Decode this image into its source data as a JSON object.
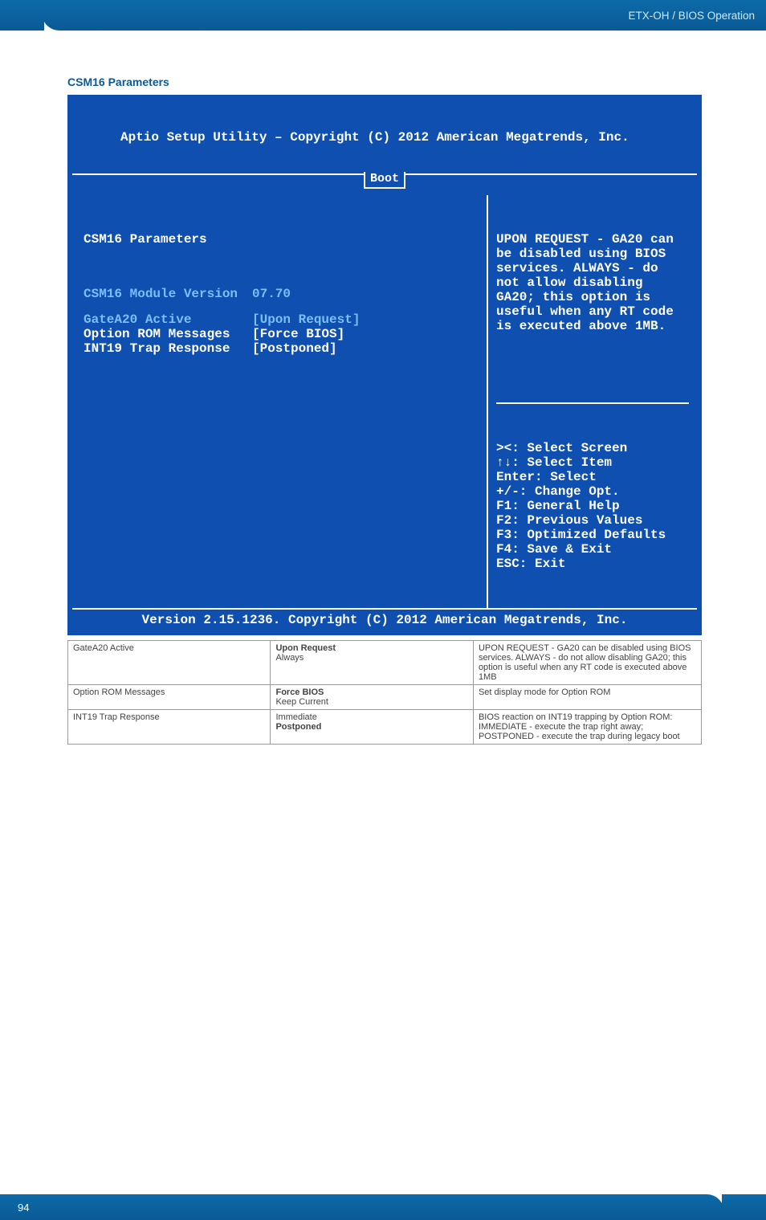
{
  "header": {
    "breadcrumb": "ETX-OH / BIOS Operation"
  },
  "section": {
    "title": "CSM16 Parameters"
  },
  "bios": {
    "title_line": "Aptio Setup Utility – Copyright (C) 2012 American Megatrends, Inc.",
    "tab": "Boot",
    "group_heading": "CSM16 Parameters",
    "items": [
      {
        "label": "CSM16 Module Version",
        "value": "07.70",
        "style": "dim"
      },
      {
        "label": "GateA20 Active",
        "value": "[Upon Request]",
        "style": "dim"
      },
      {
        "label": "Option ROM Messages",
        "value": "[Force BIOS]",
        "style": "sel"
      },
      {
        "label": "INT19 Trap Response",
        "value": "[Postponed]",
        "style": "sel"
      }
    ],
    "help_text": "UPON REQUEST - GA20 can be disabled using BIOS services. ALWAYS - do not allow disabling GA20; this option is useful when any RT code is executed above 1MB.",
    "keys": [
      "><: Select Screen",
      "↑↓: Select Item",
      "Enter: Select",
      "+/-: Change Opt.",
      "F1: General Help",
      "F2: Previous Values",
      "F3: Optimized Defaults",
      "F4: Save & Exit",
      "ESC: Exit"
    ],
    "footer": "Version 2.15.1236. Copyright (C) 2012 American Megatrends, Inc."
  },
  "table": {
    "rows": [
      {
        "name": "GateA20 Active",
        "options": [
          {
            "t": "Upon Request",
            "b": true
          },
          {
            "t": "Always",
            "b": false
          }
        ],
        "desc": "UPON REQUEST - GA20 can be disabled using BIOS services. ALWAYS - do not allow disabling GA20; this option is useful when any RT code is executed above 1MB"
      },
      {
        "name": "Option ROM Messages",
        "options": [
          {
            "t": "Force BIOS",
            "b": true
          },
          {
            "t": "Keep Current",
            "b": false
          }
        ],
        "desc": "Set display mode for Option ROM"
      },
      {
        "name": "INT19 Trap Response",
        "options": [
          {
            "t": "Immediate",
            "b": false
          },
          {
            "t": "Postponed",
            "b": true
          }
        ],
        "desc": "BIOS reaction on INT19 trapping by Option ROM: IMMEDIATE - execute the trap right away; POSTPONED - execute the trap during legacy boot"
      }
    ]
  },
  "footer": {
    "page": "94"
  }
}
